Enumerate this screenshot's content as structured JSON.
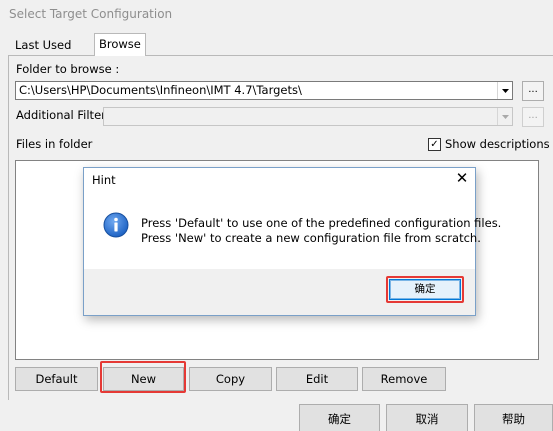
{
  "window": {
    "title": "Select Target Configuration"
  },
  "tabs": [
    {
      "label": "Last Used"
    },
    {
      "label": "Browse"
    }
  ],
  "browse": {
    "folder_label": "Folder to browse :",
    "folder_value": "C:\\Users\\HP\\Documents\\Infineon\\IMT 4.7\\Targets\\",
    "folder_browse_label": "...",
    "filter_label": "Additional Filter:",
    "filter_value": "",
    "filter_browse_label": "...",
    "files_label": "Files in folder",
    "show_descriptions_label": "Show descriptions",
    "show_descriptions_checked": true
  },
  "actions": {
    "default_label": "Default",
    "new_label": "New",
    "copy_label": "Copy",
    "edit_label": "Edit",
    "remove_label": "Remove"
  },
  "footer": {
    "ok_label": "确定",
    "cancel_label": "取消",
    "help_label": "帮助"
  },
  "dialog": {
    "title": "Hint",
    "line1": "Press 'Default' to use one of the predefined configuration files.",
    "line2": "Press 'New' to create a new configuration file from scratch.",
    "ok_label": "确定"
  },
  "colors": {
    "highlight": "#e53935",
    "info_icon": "#1e63c4"
  }
}
